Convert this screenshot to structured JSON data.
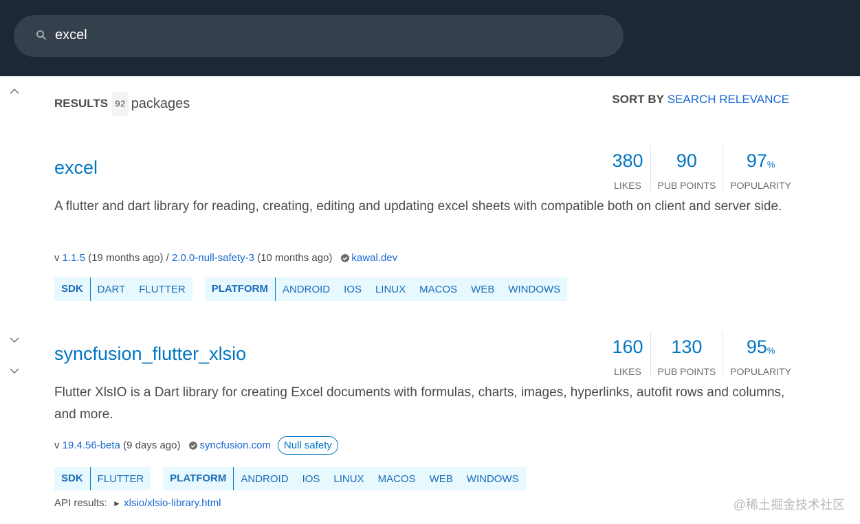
{
  "search": {
    "query": "excel"
  },
  "results": {
    "label": "RESULTS",
    "count": "92",
    "unit": "packages"
  },
  "sort": {
    "label": "SORT BY",
    "value": "SEARCH RELEVANCE"
  },
  "packages": [
    {
      "name": "excel",
      "description": "A flutter and dart library for reading, creating, editing and updating excel sheets with compatible both on client and server side.",
      "meta": {
        "v_prefix": "v",
        "version": "1.1.5",
        "version_age": "(19 months ago) /",
        "prerelease": "2.0.0-null-safety-3",
        "prerelease_age": "(10 months ago)",
        "publisher": "kawal.dev"
      },
      "scores": [
        {
          "value": "380",
          "suffix": "",
          "label": "LIKES"
        },
        {
          "value": "90",
          "suffix": "",
          "label": "PUB POINTS"
        },
        {
          "value": "97",
          "suffix": "%",
          "label": "POPULARITY"
        }
      ],
      "sdk_tags": {
        "head": "SDK",
        "items": [
          "DART",
          "FLUTTER"
        ]
      },
      "platform_tags": {
        "head": "PLATFORM",
        "items": [
          "ANDROID",
          "IOS",
          "LINUX",
          "MACOS",
          "WEB",
          "WINDOWS"
        ]
      }
    },
    {
      "name": "syncfusion_flutter_xlsio",
      "description": "Flutter XlsIO is a Dart library for creating Excel documents with formulas, charts, images, hyperlinks, autofit rows and columns, and more.",
      "meta": {
        "v_prefix": "v",
        "version": "19.4.56-beta",
        "version_age": "(9 days ago)",
        "publisher": "syncfusion.com",
        "badge": "Null safety"
      },
      "scores": [
        {
          "value": "160",
          "suffix": "",
          "label": "LIKES"
        },
        {
          "value": "130",
          "suffix": "",
          "label": "PUB POINTS"
        },
        {
          "value": "95",
          "suffix": "%",
          "label": "POPULARITY"
        }
      ],
      "sdk_tags": {
        "head": "SDK",
        "items": [
          "FLUTTER"
        ]
      },
      "platform_tags": {
        "head": "PLATFORM",
        "items": [
          "ANDROID",
          "IOS",
          "LINUX",
          "MACOS",
          "WEB",
          "WINDOWS"
        ]
      },
      "api": {
        "label": "API results:",
        "marker": "►",
        "link": "xlsio/xlsio-library.html"
      }
    }
  ],
  "watermark": "@稀土掘金技术社区",
  "colors": {
    "topbar": "#1c2834",
    "search_box": "#35404d",
    "link": "#0175c2",
    "tag_bg": "#e7f8ff"
  },
  "icons": [
    "search-icon",
    "chevron-up-icon",
    "chevron-down-icon",
    "verified-icon"
  ]
}
